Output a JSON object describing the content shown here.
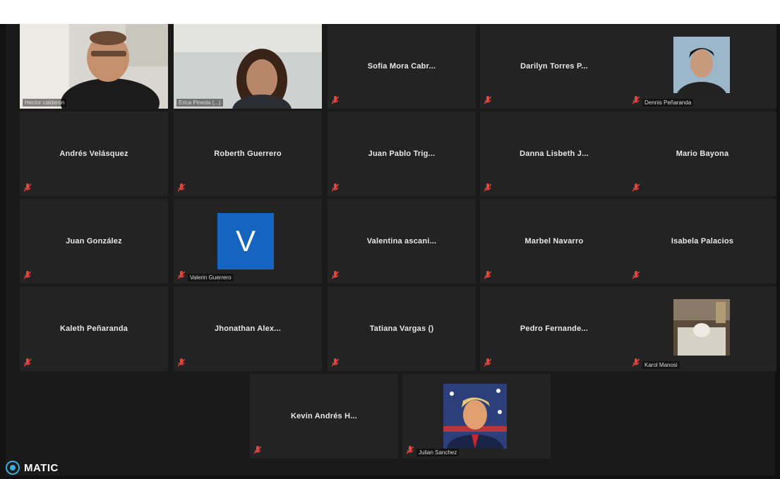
{
  "tiles": [
    {
      "name": "",
      "label": "Hector calderon",
      "kind": "video1"
    },
    {
      "name": "",
      "label": "Erica Pineda (...)",
      "kind": "video2"
    },
    {
      "name": "Sofia Mora Cabr...",
      "label": "",
      "kind": "name"
    },
    {
      "name": "Darilyn Torres P...",
      "label": "",
      "kind": "name"
    },
    {
      "name": "",
      "label": "Dennis Peñaranda",
      "kind": "photo1"
    },
    {
      "name": "Andrés Velásquez",
      "label": "",
      "kind": "name"
    },
    {
      "name": "Roberth Guerrero",
      "label": "",
      "kind": "name"
    },
    {
      "name": "Juan Pablo Trig...",
      "label": "",
      "kind": "name"
    },
    {
      "name": "Danna Lisbeth J...",
      "label": "",
      "kind": "name"
    },
    {
      "name": "Mario Bayona",
      "label": "",
      "kind": "name"
    },
    {
      "name": "Juan González",
      "label": "",
      "kind": "name"
    },
    {
      "name": "",
      "label": "Valerin Guerrero",
      "kind": "avatar",
      "initial": "V"
    },
    {
      "name": "Valentina ascani...",
      "label": "",
      "kind": "name"
    },
    {
      "name": "Marbel Navarro",
      "label": "",
      "kind": "name"
    },
    {
      "name": "Isabela Palacios",
      "label": "",
      "kind": "name"
    },
    {
      "name": "Kaleth Peñaranda",
      "label": "",
      "kind": "name"
    },
    {
      "name": "Jhonathan Alex...",
      "label": "",
      "kind": "name"
    },
    {
      "name": "Tatiana Vargas ()",
      "label": "",
      "kind": "name"
    },
    {
      "name": "Pedro Fernande...",
      "label": "",
      "kind": "name"
    },
    {
      "name": "",
      "label": "Karol Manosi",
      "kind": "photo2"
    },
    {
      "name": "Kevin Andrés H...",
      "label": "",
      "kind": "name"
    },
    {
      "name": "",
      "label": "Julian Sanchez",
      "kind": "photo3"
    }
  ],
  "watermark": {
    "text": "MATIC"
  },
  "colors": {
    "muted_mic": "#e0483e",
    "active_border": "#c9d86a",
    "avatar_bg": "#1565c0",
    "brand": "#3fa9d8"
  }
}
